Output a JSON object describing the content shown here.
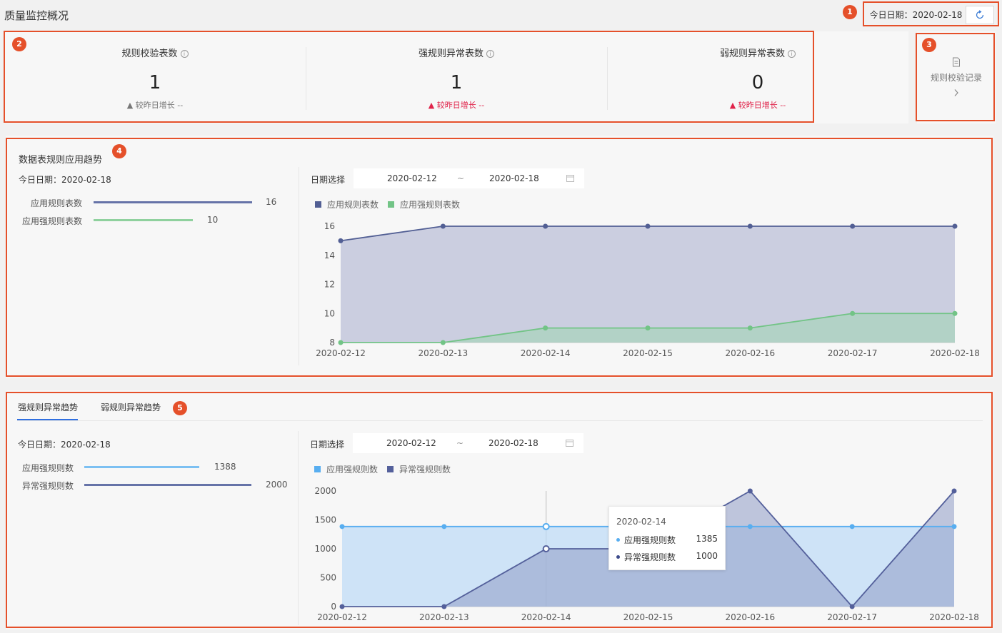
{
  "header": {
    "title": "质量监控概况",
    "today_label": "今日日期：",
    "today_value": "2020-02-18",
    "refresh_icon": "refresh-icon"
  },
  "badges": [
    "1",
    "2",
    "3",
    "4",
    "5"
  ],
  "stats": [
    {
      "title": "规则校验表数",
      "value": "1",
      "growth": "较昨日增长 --",
      "growth_color": "#777777"
    },
    {
      "title": "强规则异常表数",
      "value": "1",
      "growth": "较昨日增长 --",
      "growth_color": "#e0234a"
    },
    {
      "title": "弱规则异常表数",
      "value": "0",
      "growth": "较昨日增长 --",
      "growth_color": "#e0234a"
    }
  ],
  "records": {
    "label": "规则校验记录",
    "icon": "document-icon",
    "arrow_icon": "chevron-right-icon"
  },
  "trend1": {
    "title": "数据表规则应用趋势",
    "today": "今日日期：2020-02-18",
    "bars": [
      {
        "label": "应用规则表数",
        "value": "16",
        "fraction": 1.0,
        "color": "#6673a8"
      },
      {
        "label": "应用强规则表数",
        "value": "10",
        "fraction": 0.625,
        "color": "#8fd19e"
      }
    ],
    "date_label": "日期选择",
    "date_start": "2020-02-12",
    "date_sep": "~",
    "date_end": "2020-02-18",
    "calendar_icon": "calendar-icon"
  },
  "trend2": {
    "tabs": [
      "强规则异常趋势",
      "弱规则异常趋势"
    ],
    "today": "今日日期：2020-02-18",
    "bars": [
      {
        "label": "应用强规则数",
        "value": "1388",
        "fraction": 0.69,
        "color": "#7cc0f2"
      },
      {
        "label": "异常强规则数",
        "value": "2000",
        "fraction": 1.0,
        "color": "#6673a8"
      }
    ],
    "date_label": "日期选择",
    "date_start": "2020-02-12",
    "date_sep": "~",
    "date_end": "2020-02-18",
    "calendar_icon": "calendar-icon",
    "tooltip": {
      "date": "2020-02-14",
      "rows": [
        {
          "label": "应用强规则数",
          "value": "1385",
          "color": "#58aef0"
        },
        {
          "label": "异常强规则数",
          "value": "1000",
          "color": "#3c4a8a"
        }
      ]
    }
  },
  "chart_data": [
    {
      "type": "area",
      "x": [
        "2020-02-12",
        "2020-02-13",
        "2020-02-14",
        "2020-02-15",
        "2020-02-16",
        "2020-02-17",
        "2020-02-18"
      ],
      "series": [
        {
          "name": "应用规则表数",
          "values": [
            15,
            16,
            16,
            16,
            16,
            16,
            16
          ],
          "color": "#525f94"
        },
        {
          "name": "应用强规则表数",
          "values": [
            8,
            8,
            9,
            9,
            9,
            10,
            10
          ],
          "color": "#72c486"
        }
      ],
      "ylim": [
        8,
        16
      ],
      "yticks": [
        "8",
        "10",
        "12",
        "14",
        "16"
      ],
      "grid": false,
      "legend": "top-left"
    },
    {
      "type": "area",
      "x": [
        "2020-02-12",
        "2020-02-13",
        "2020-02-14",
        "2020-02-15",
        "2020-02-16",
        "2020-02-17",
        "2020-02-18"
      ],
      "series": [
        {
          "name": "应用强规则数",
          "values": [
            1385,
            1385,
            1385,
            1385,
            1385,
            1385,
            1385
          ],
          "color": "#58aef0"
        },
        {
          "name": "异常强规则数",
          "values": [
            0,
            0,
            1000,
            1000,
            2000,
            0,
            2000
          ],
          "color": "#54609b"
        }
      ],
      "ylim": [
        0,
        2000
      ],
      "yticks": [
        "0",
        "500",
        "1000",
        "1500",
        "2000"
      ],
      "grid": false,
      "legend": "top-left"
    }
  ]
}
